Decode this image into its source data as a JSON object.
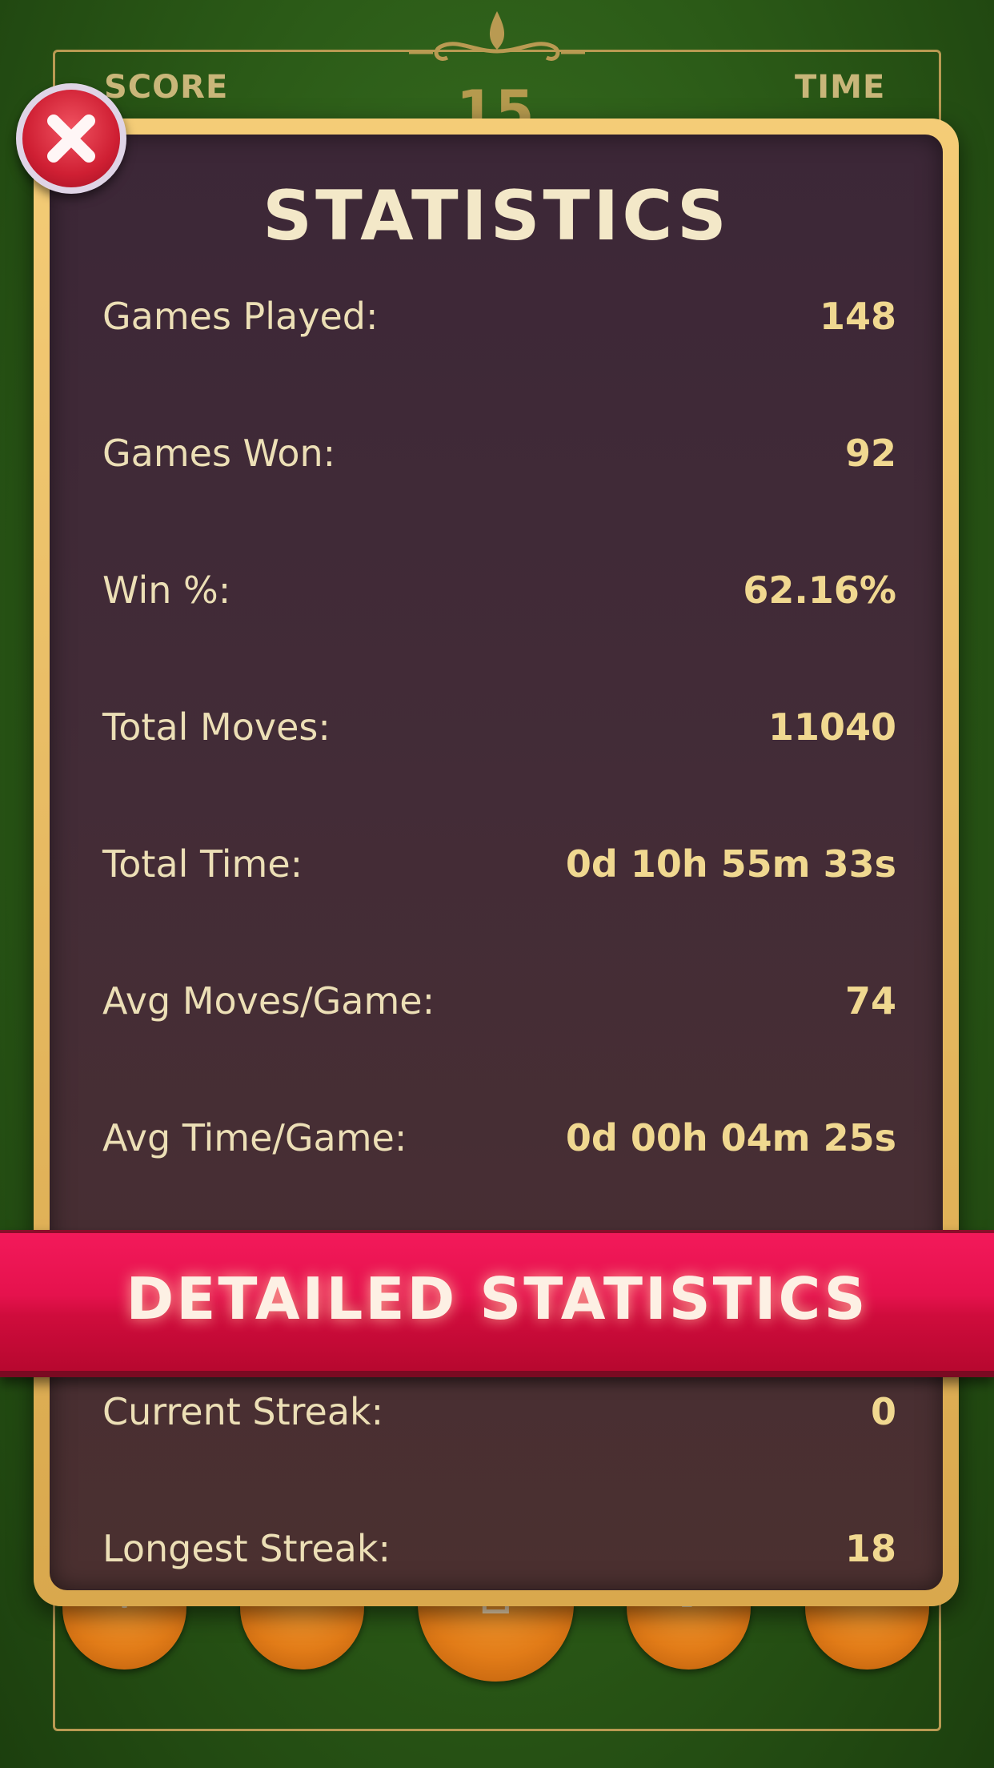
{
  "hud": {
    "score_label": "SCORE",
    "score_value": "15",
    "time_label": "TIME"
  },
  "modal": {
    "title": "STATISTICS",
    "stats": [
      {
        "label": "Games Played:",
        "value": "148"
      },
      {
        "label": "Games Won:",
        "value": "92"
      },
      {
        "label": "Win %:",
        "value": "62.16%"
      },
      {
        "label": "Total Moves:",
        "value": "11040"
      },
      {
        "label": "Total Time:",
        "value": "0d 10h 55m 33s"
      },
      {
        "label": "Avg Moves/Game:",
        "value": "74"
      },
      {
        "label": "Avg Time/Game:",
        "value": "0d 00h 04m 25s"
      },
      {
        "label": "Current Streak:",
        "value": "0"
      },
      {
        "label": "Longest Streak:",
        "value": "18"
      }
    ]
  },
  "banner": {
    "label": "DETAILED STATISTICS"
  },
  "toolbar": {
    "icons": [
      "gear-icon",
      "cards-icon",
      "deal-icon",
      "help-icon",
      "restart-icon"
    ]
  },
  "colors": {
    "felt_green": "#2b5a17",
    "panel_gold": "#e8b85f",
    "panel_bg": "#432c37",
    "banner_red": "#e5124d",
    "close_red": "#cf1f33",
    "value_gold": "#f0d890"
  }
}
